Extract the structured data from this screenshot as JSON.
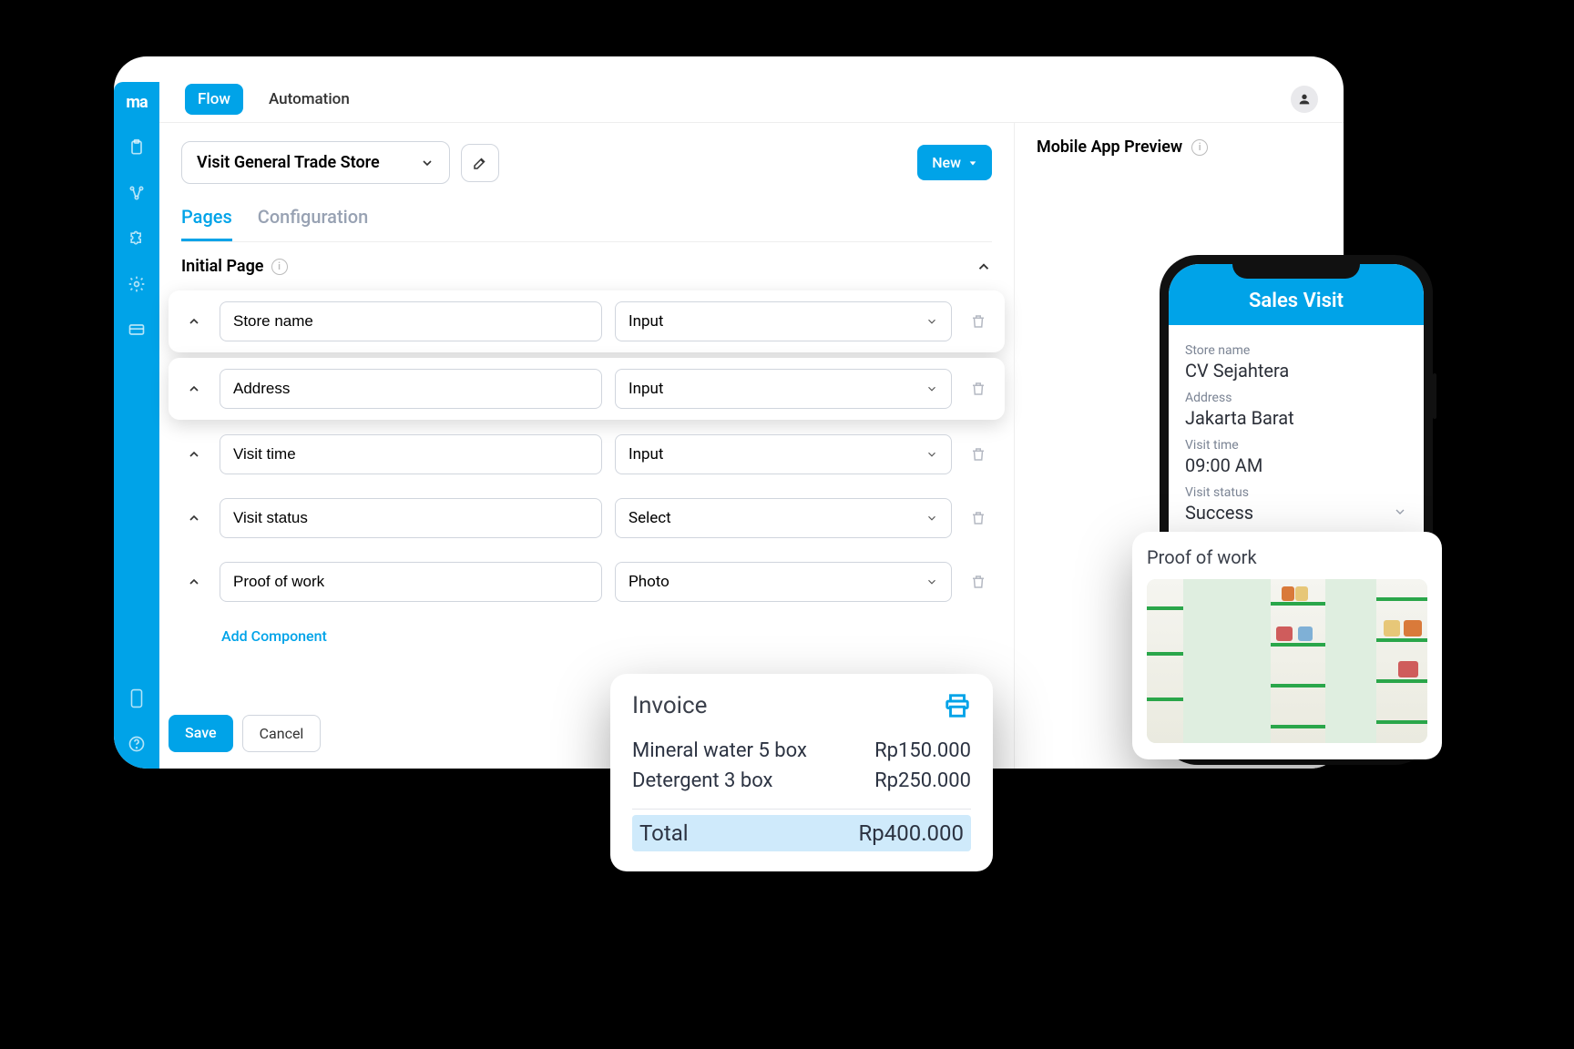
{
  "logo": "ma",
  "topbar": {
    "flow": "Flow",
    "automation": "Automation"
  },
  "selector": {
    "title": "Visit General Trade Store"
  },
  "new_button": "New",
  "subtabs": {
    "pages": "Pages",
    "configuration": "Configuration"
  },
  "section": {
    "title": "Initial Page"
  },
  "rows": [
    {
      "label": "Store name",
      "type": "Input"
    },
    {
      "label": "Address",
      "type": "Input"
    },
    {
      "label": "Visit time",
      "type": "Input"
    },
    {
      "label": "Visit status",
      "type": "Select"
    },
    {
      "label": "Proof of work",
      "type": "Photo"
    }
  ],
  "add_component": "Add Component",
  "actions": {
    "save": "Save",
    "cancel": "Cancel"
  },
  "preview": {
    "heading": "Mobile App Preview",
    "app_title": "Sales Visit",
    "fields": [
      {
        "label": "Store name",
        "value": "CV Sejahtera"
      },
      {
        "label": "Address",
        "value": "Jakarta Barat"
      },
      {
        "label": "Visit time",
        "value": "09:00 AM"
      },
      {
        "label": "Visit status",
        "value": "Success"
      }
    ]
  },
  "proof": {
    "title": "Proof of work"
  },
  "invoice": {
    "title": "Invoice",
    "items": [
      {
        "name": "Mineral water 5 box",
        "price": "Rp150.000"
      },
      {
        "name": "Detergent 3 box",
        "price": "Rp250.000"
      }
    ],
    "total_label": "Total",
    "total_value": "Rp400.000"
  }
}
